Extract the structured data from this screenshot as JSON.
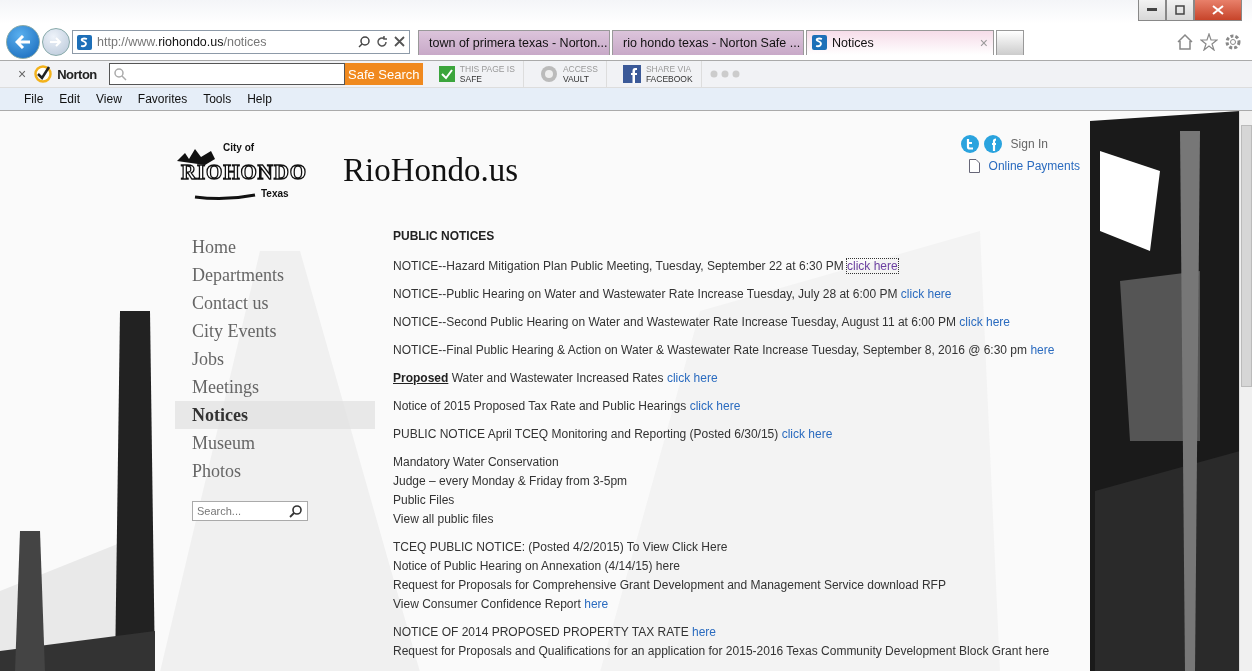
{
  "browser": {
    "address": {
      "prefix": "http://www.",
      "domain": "riohondo.us",
      "path": "/notices"
    },
    "tabs": [
      {
        "label": "town of primera texas - Norton...",
        "selected": false
      },
      {
        "label": "rio hondo texas - Norton Safe ...",
        "selected": false
      },
      {
        "label": "Notices",
        "selected": true,
        "close": "×"
      }
    ]
  },
  "norton": {
    "close": "×",
    "brand": "Norton",
    "search_button": "Safe Search",
    "badges": [
      {
        "kind": "check",
        "top": "THIS PAGE IS",
        "bottom": "SAFE"
      },
      {
        "kind": "vault",
        "top": "ACCESS",
        "bottom": "VAULT"
      },
      {
        "kind": "facebook",
        "top": "SHARE VIA",
        "bottom": "FACEBOOK"
      }
    ]
  },
  "menu": [
    "File",
    "Edit",
    "View",
    "Favorites",
    "Tools",
    "Help"
  ],
  "site": {
    "logo": {
      "top": "City of",
      "main": "RIOHONDO",
      "bottom": "Texas"
    },
    "title": "RioHondo.us",
    "sign_in": "Sign In",
    "payments": "Online Payments"
  },
  "nav": [
    {
      "label": "Home",
      "selected": false
    },
    {
      "label": "Departments",
      "selected": false
    },
    {
      "label": "Contact us",
      "selected": false
    },
    {
      "label": "City Events",
      "selected": false
    },
    {
      "label": "Jobs",
      "selected": false
    },
    {
      "label": "Meetings",
      "selected": false
    },
    {
      "label": "Notices",
      "selected": true
    },
    {
      "label": "Museum",
      "selected": false
    },
    {
      "label": "Photos",
      "selected": false
    }
  ],
  "search": {
    "placeholder": "Search..."
  },
  "notices": {
    "heading": "PUBLIC NOTICES",
    "blocks": [
      {
        "lines": [
          {
            "text": "NOTICE--Hazard Mitigation Plan Public Meeting, Tuesday, September 22 at 6:30 PM",
            "link": "click here",
            "visited": true
          }
        ]
      },
      {
        "lines": [
          {
            "text": "NOTICE--Public Hearing on Water and Wastewater Rate Increase Tuesday, July 28 at 6:00 PM",
            "link": "click here",
            "visited": false
          }
        ]
      },
      {
        "lines": [
          {
            "text": "NOTICE--Second Public Hearing on Water and Wastewater Rate Increase Tuesday, August 11 at 6:00 PM",
            "link": "click here",
            "visited": false
          }
        ]
      },
      {
        "lines": [
          {
            "text": "NOTICE--Final Public Hearing & Action on Water & Wastewater Rate Increase Tuesday, September 8, 2016 @ 6:30 pm",
            "link": "here",
            "visited": false
          }
        ]
      },
      {
        "lines": [
          {
            "text": "**Proposed** Water and Wastewater Increased Rates",
            "link": "click here",
            "visited": false
          }
        ]
      },
      {
        "lines": [
          {
            "text": "Notice of 2015 Proposed Tax Rate and Public Hearings",
            "link": "click here",
            "visited": false
          }
        ]
      },
      {
        "lines": [
          {
            "text": "PUBLIC NOTICE April TCEQ Monitoring and Reporting (Posted 6/30/15)",
            "link": "click here",
            "visited": false
          }
        ]
      },
      {
        "lines": [
          {
            "text": "Mandatory Water Conservation"
          },
          {
            "text": "Judge – every Monday & Friday from 3-5pm"
          },
          {
            "text": "Public Files"
          },
          {
            "text": "View all public files"
          }
        ]
      },
      {
        "lines": [
          {
            "text": "TCEQ PUBLIC NOTICE: (Posted 4/2/2015) To View Click Here"
          },
          {
            "text": "Notice of Public Hearing on Annexation (4/14/15) here"
          },
          {
            "text": "Request for Proposals for Comprehensive Grant Development and Management Service download RFP"
          },
          {
            "text": "View Consumer Confidence Report",
            "link": "here",
            "visited": false
          }
        ]
      },
      {
        "lines": [
          {
            "text": "NOTICE OF 2014 PROPOSED PROPERTY TAX RATE",
            "link": "here",
            "visited": false
          },
          {
            "text": "Request for Proposals and Qualifications for an application for 2015-2016 Texas Community Development Block Grant here"
          }
        ]
      }
    ]
  }
}
